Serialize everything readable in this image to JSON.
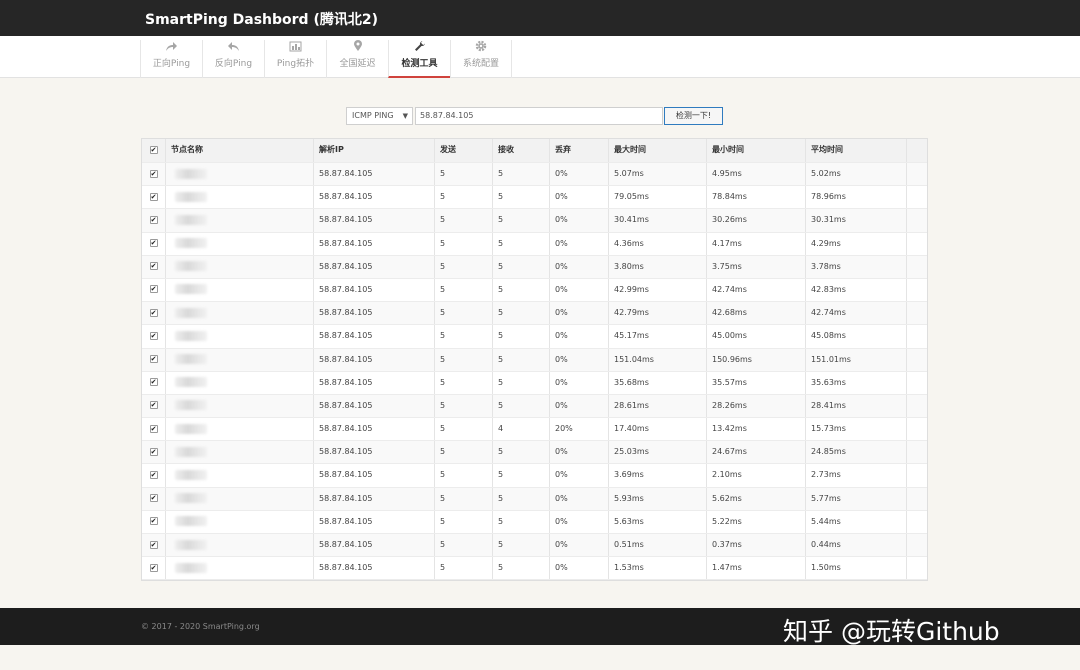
{
  "app": {
    "title": "SmartPing Dashbord (腾讯北2)"
  },
  "nav": [
    {
      "label": "正向Ping",
      "icon": "share-icon"
    },
    {
      "label": "反向Ping",
      "icon": "reply-icon"
    },
    {
      "label": "Ping拓扑",
      "icon": "bar-chart-icon"
    },
    {
      "label": "全国延迟",
      "icon": "map-marker-icon"
    },
    {
      "label": "检测工具",
      "icon": "wrench-icon",
      "active": true
    },
    {
      "label": "系统配置",
      "icon": "gear-icon"
    }
  ],
  "tool": {
    "protocol": "ICMP PING",
    "target": "58.87.84.105",
    "button": "检测一下!"
  },
  "table": {
    "columns": [
      "节点名称",
      "解析IP",
      "发送",
      "接收",
      "丢弃",
      "最大时间",
      "最小时间",
      "平均时间"
    ],
    "rows": [
      [
        "58.87.84.105",
        "5",
        "5",
        "0%",
        "5.07ms",
        "4.95ms",
        "5.02ms"
      ],
      [
        "58.87.84.105",
        "5",
        "5",
        "0%",
        "79.05ms",
        "78.84ms",
        "78.96ms"
      ],
      [
        "58.87.84.105",
        "5",
        "5",
        "0%",
        "30.41ms",
        "30.26ms",
        "30.31ms"
      ],
      [
        "58.87.84.105",
        "5",
        "5",
        "0%",
        "4.36ms",
        "4.17ms",
        "4.29ms"
      ],
      [
        "58.87.84.105",
        "5",
        "5",
        "0%",
        "3.80ms",
        "3.75ms",
        "3.78ms"
      ],
      [
        "58.87.84.105",
        "5",
        "5",
        "0%",
        "42.99ms",
        "42.74ms",
        "42.83ms"
      ],
      [
        "58.87.84.105",
        "5",
        "5",
        "0%",
        "42.79ms",
        "42.68ms",
        "42.74ms"
      ],
      [
        "58.87.84.105",
        "5",
        "5",
        "0%",
        "45.17ms",
        "45.00ms",
        "45.08ms"
      ],
      [
        "58.87.84.105",
        "5",
        "5",
        "0%",
        "151.04ms",
        "150.96ms",
        "151.01ms"
      ],
      [
        "58.87.84.105",
        "5",
        "5",
        "0%",
        "35.68ms",
        "35.57ms",
        "35.63ms"
      ],
      [
        "58.87.84.105",
        "5",
        "5",
        "0%",
        "28.61ms",
        "28.26ms",
        "28.41ms"
      ],
      [
        "58.87.84.105",
        "5",
        "4",
        "20%",
        "17.40ms",
        "13.42ms",
        "15.73ms"
      ],
      [
        "58.87.84.105",
        "5",
        "5",
        "0%",
        "25.03ms",
        "24.67ms",
        "24.85ms"
      ],
      [
        "58.87.84.105",
        "5",
        "5",
        "0%",
        "3.69ms",
        "2.10ms",
        "2.73ms"
      ],
      [
        "58.87.84.105",
        "5",
        "5",
        "0%",
        "5.93ms",
        "5.62ms",
        "5.77ms"
      ],
      [
        "58.87.84.105",
        "5",
        "5",
        "0%",
        "5.63ms",
        "5.22ms",
        "5.44ms"
      ],
      [
        "58.87.84.105",
        "5",
        "5",
        "0%",
        "0.51ms",
        "0.37ms",
        "0.44ms"
      ],
      [
        "58.87.84.105",
        "5",
        "5",
        "0%",
        "1.53ms",
        "1.47ms",
        "1.50ms"
      ]
    ]
  },
  "footer": {
    "copyright": "© 2017 - 2020 SmartPing.org",
    "watermark": "知乎 @玩转Github"
  },
  "colors": {
    "topbar": "#262626",
    "active_underline": "#d0433c",
    "button_border": "#2f7bbf",
    "background": "#f7f5f0"
  }
}
